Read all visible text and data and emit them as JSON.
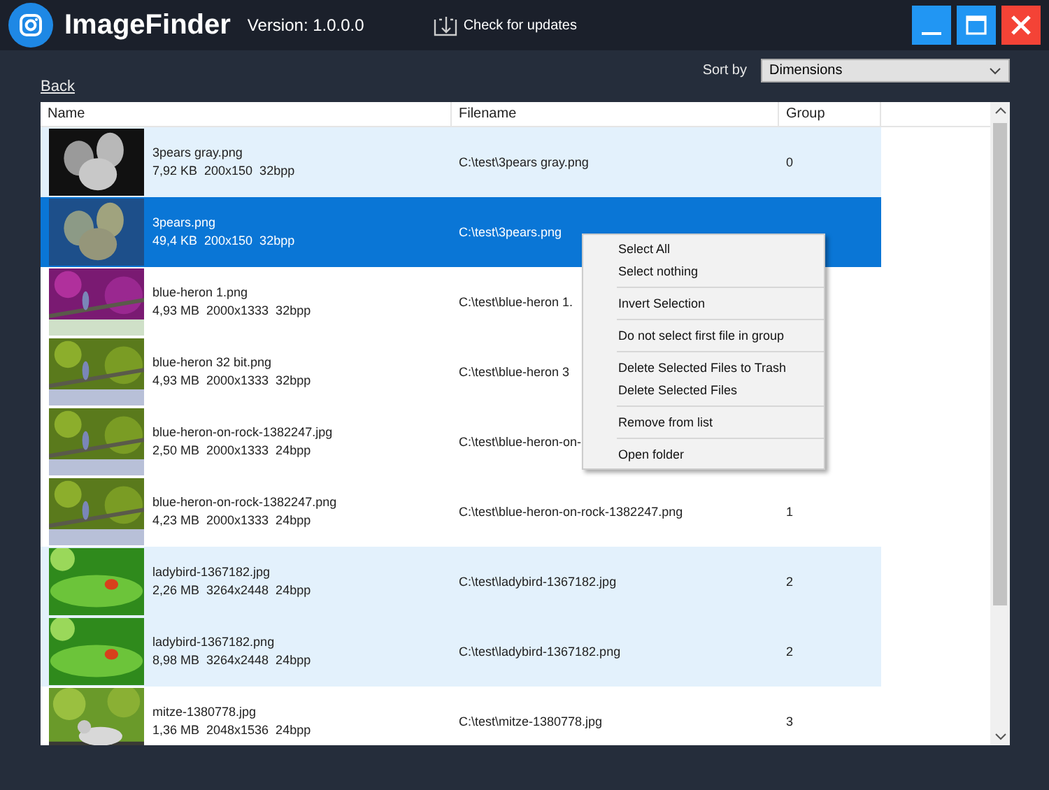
{
  "window": {
    "title": "ImageFinder",
    "version": "Version: 1.0.0.0",
    "update_button": "Check for updates"
  },
  "toolbar": {
    "back_link": "Back",
    "sort_label": "Sort by",
    "sort_value": "Dimensions"
  },
  "table": {
    "columns": [
      "Name",
      "Filename",
      "Group"
    ],
    "rows": [
      {
        "name": "3pears gray.png",
        "details": "7,92 KB  200x150  32bpp",
        "filename": "C:\\test\\3pears gray.png",
        "group": "0",
        "shaded": true,
        "selected": false
      },
      {
        "name": "3pears.png",
        "details": "49,4 KB  200x150  32bpp",
        "filename": "C:\\test\\3pears.png",
        "shaded": false,
        "selected": true
      },
      {
        "name": "blue-heron 1.png",
        "details": "4,93 MB  2000x1333  32bpp",
        "filename": "C:\\test\\blue-heron 1.",
        "shaded": false,
        "selected": false
      },
      {
        "name": "blue-heron 32 bit.png",
        "details": "4,93 MB  2000x1333  32bpp",
        "filename": "C:\\test\\blue-heron 3",
        "shaded": false,
        "selected": false
      },
      {
        "name": "blue-heron-on-rock-1382247.jpg",
        "details": "2,50 MB  2000x1333  24bpp",
        "filename": "C:\\test\\blue-heron-on-",
        "shaded": false,
        "selected": false
      },
      {
        "name": "blue-heron-on-rock-1382247.png",
        "details": "4,23 MB  2000x1333  24bpp",
        "filename": "C:\\test\\blue-heron-on-rock-1382247.png",
        "group": "1",
        "shaded": false,
        "selected": false
      },
      {
        "name": "ladybird-1367182.jpg",
        "details": "2,26 MB  3264x2448  24bpp",
        "filename": "C:\\test\\ladybird-1367182.jpg",
        "group": "2",
        "shaded": true,
        "selected": false
      },
      {
        "name": "ladybird-1367182.png",
        "details": "8,98 MB  3264x2448  24bpp",
        "filename": "C:\\test\\ladybird-1367182.png",
        "group": "2",
        "shaded": true,
        "selected": false
      },
      {
        "name": "mitze-1380778.jpg",
        "details": "1,36 MB  2048x1536  24bpp",
        "filename": "C:\\test\\mitze-1380778.jpg",
        "group": "3",
        "shaded": false,
        "selected": false
      }
    ]
  },
  "context_menu": {
    "groups": [
      [
        "Select All",
        "Select nothing"
      ],
      [
        "Invert Selection"
      ],
      [
        "Do not select first file in group"
      ],
      [
        "Delete Selected Files to Trash",
        "Delete Selected Files"
      ],
      [
        "Remove from list"
      ],
      [
        "Open folder"
      ]
    ]
  }
}
